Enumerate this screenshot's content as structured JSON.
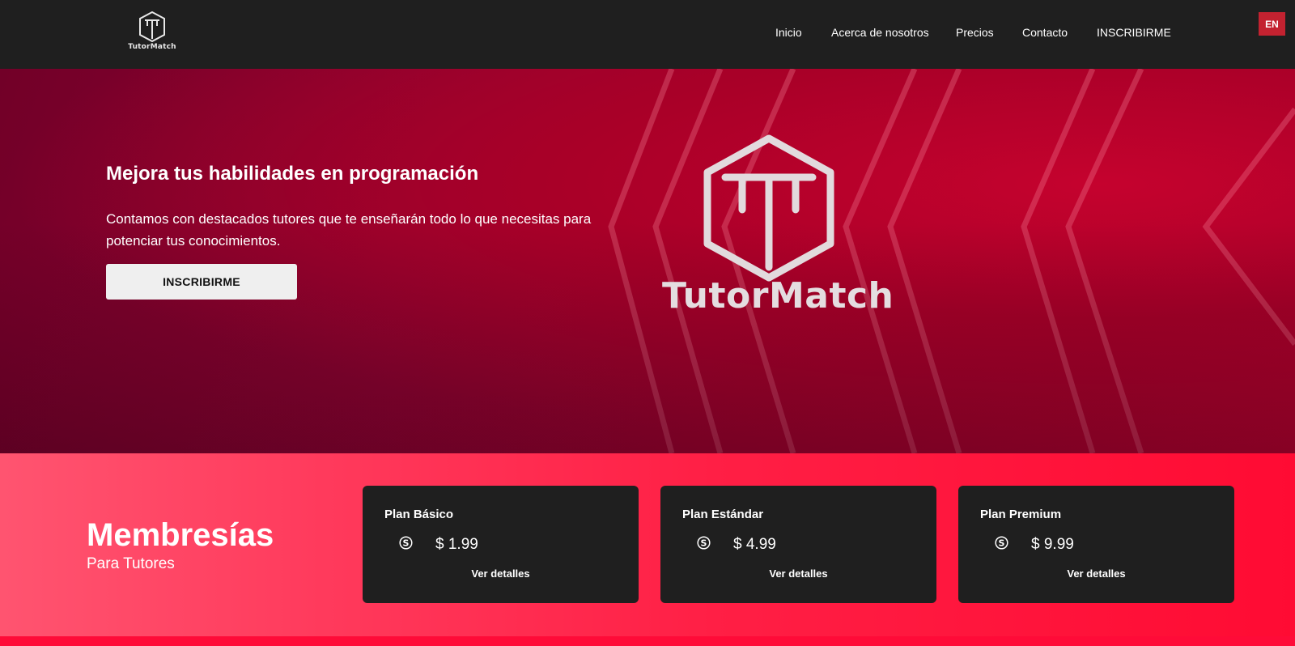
{
  "header": {
    "logo_text": "TutorMatch",
    "nav": [
      {
        "label": "Inicio"
      },
      {
        "label": "Acerca de nosotros"
      },
      {
        "label": "Precios"
      },
      {
        "label": "Contacto"
      },
      {
        "label": "INSCRIBIRME"
      }
    ],
    "language_button": "EN"
  },
  "hero": {
    "title": "Mejora tus habilidades en programación",
    "text": "Contamos con destacados tutores que te enseñarán todo lo que necesitas para potenciar tus conocimientos.",
    "cta_label": "INSCRIBIRME",
    "logo_text": "TutorMatch"
  },
  "memberships": {
    "title": "Membresías",
    "subtitle": "Para Tutores",
    "plans": [
      {
        "name": "Plan Básico",
        "price": "$ 1.99",
        "details_label": "Ver detalles"
      },
      {
        "name": "Plan Estándar",
        "price": "$ 4.99",
        "details_label": "Ver detalles"
      },
      {
        "name": "Plan Premium",
        "price": "$ 9.99",
        "details_label": "Ver detalles"
      }
    ]
  },
  "icons": {
    "logo": "tutormatch-logo-icon",
    "coin": "dollar-coin-icon"
  },
  "colors": {
    "header_bg": "#1f1f1f",
    "accent_red": "#ff0b38",
    "lang_button_bg": "#c32230",
    "card_bg": "#1f1f1f"
  }
}
